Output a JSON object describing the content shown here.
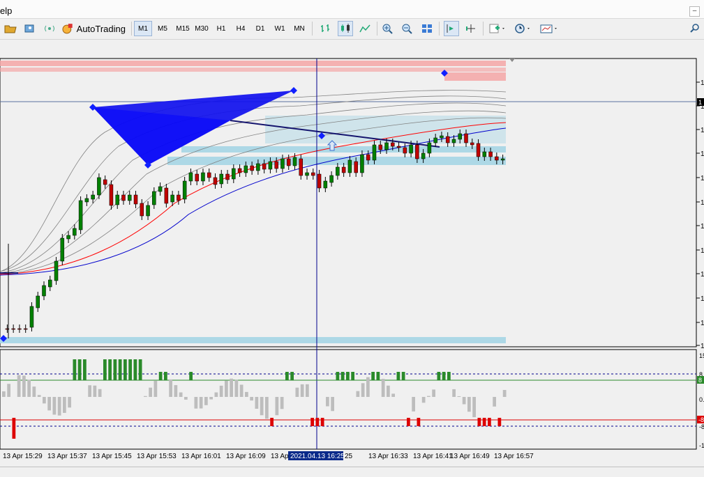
{
  "menubar": {
    "help_label": "elp",
    "minimize_label": "–"
  },
  "toolbar": {
    "autotrading_label": "AutoTrading",
    "timeframes": [
      "M1",
      "M5",
      "M15",
      "M30",
      "H1",
      "H4",
      "D1",
      "W1",
      "MN"
    ],
    "active_timeframe": "M1",
    "left_icons": [
      "folder-icon",
      "profiles-icon",
      "signal-icon"
    ],
    "right_icons": [
      "bar-chart-icon",
      "candlestick-icon",
      "line-chart-icon",
      "zoom-in-icon",
      "zoom-out-icon",
      "tile-windows-icon",
      "autoscroll-icon",
      "chart-shift-icon",
      "indicators-icon",
      "periods-icon",
      "templates-icon",
      "search-icon"
    ]
  },
  "chart_data": {
    "type": "candlestick",
    "symbol_note": "",
    "time_axis_labels": [
      "13 Apr 15:29",
      "13 Apr 15:37",
      "13 Apr 15:45",
      "13 Apr 15:53",
      "13 Apr 16:01",
      "13 Apr 16:09",
      "13 Apr",
      "25",
      "13 Apr 16:33",
      "13 Apr 16:41",
      "13 Apr 16:49",
      "13 Apr 16:57"
    ],
    "crosshair_label": "2021.04.13 16:25",
    "price_axis_labels": [
      "1",
      "1",
      "1",
      "1",
      "1",
      "1",
      "1",
      "1",
      "1",
      "1",
      "1",
      "1",
      "1",
      "1"
    ],
    "price_marker": "1",
    "candles": [
      {
        "o": 392,
        "c": 392
      },
      {
        "o": 392,
        "c": 392
      },
      {
        "o": 392,
        "c": 392
      },
      {
        "o": 392,
        "c": 392
      },
      {
        "o": 390,
        "c": 360
      },
      {
        "o": 362,
        "c": 345
      },
      {
        "o": 345,
        "c": 330
      },
      {
        "o": 332,
        "c": 322
      },
      {
        "o": 323,
        "c": 295
      },
      {
        "o": 295,
        "c": 262
      },
      {
        "o": 263,
        "c": 258
      },
      {
        "o": 258,
        "c": 248
      },
      {
        "o": 250,
        "c": 208
      },
      {
        "o": 210,
        "c": 205
      },
      {
        "o": 206,
        "c": 200
      },
      {
        "o": 200,
        "c": 175
      },
      {
        "o": 178,
        "c": 185
      },
      {
        "o": 185,
        "c": 215
      },
      {
        "o": 214,
        "c": 200
      },
      {
        "o": 200,
        "c": 208
      },
      {
        "o": 208,
        "c": 200
      },
      {
        "o": 200,
        "c": 213
      },
      {
        "o": 212,
        "c": 230
      },
      {
        "o": 230,
        "c": 215
      },
      {
        "o": 214,
        "c": 195
      },
      {
        "o": 195,
        "c": 188
      },
      {
        "o": 190,
        "c": 212
      },
      {
        "o": 210,
        "c": 200
      },
      {
        "o": 200,
        "c": 208
      },
      {
        "o": 206,
        "c": 180
      },
      {
        "o": 180,
        "c": 168
      },
      {
        "o": 170,
        "c": 180
      },
      {
        "o": 180,
        "c": 168
      },
      {
        "o": 168,
        "c": 175
      },
      {
        "o": 175,
        "c": 185
      },
      {
        "o": 184,
        "c": 170
      },
      {
        "o": 170,
        "c": 178
      },
      {
        "o": 177,
        "c": 162
      },
      {
        "o": 162,
        "c": 168
      },
      {
        "o": 168,
        "c": 158
      },
      {
        "o": 158,
        "c": 165
      },
      {
        "o": 165,
        "c": 155
      },
      {
        "o": 155,
        "c": 163
      },
      {
        "o": 163,
        "c": 152
      },
      {
        "o": 152,
        "c": 162
      },
      {
        "o": 162,
        "c": 148
      },
      {
        "o": 148,
        "c": 158
      },
      {
        "o": 158,
        "c": 146
      },
      {
        "o": 148,
        "c": 172
      },
      {
        "o": 172,
        "c": 168
      },
      {
        "o": 168,
        "c": 172
      },
      {
        "o": 170,
        "c": 190
      },
      {
        "o": 190,
        "c": 180
      },
      {
        "o": 182,
        "c": 172
      },
      {
        "o": 172,
        "c": 160
      },
      {
        "o": 160,
        "c": 168
      },
      {
        "o": 168,
        "c": 150
      },
      {
        "o": 152,
        "c": 168
      },
      {
        "o": 168,
        "c": 142
      },
      {
        "o": 142,
        "c": 150
      },
      {
        "o": 150,
        "c": 128
      },
      {
        "o": 128,
        "c": 135
      },
      {
        "o": 135,
        "c": 125
      },
      {
        "o": 125,
        "c": 130
      },
      {
        "o": 130,
        "c": 132
      },
      {
        "o": 132,
        "c": 140
      },
      {
        "o": 140,
        "c": 128
      },
      {
        "o": 128,
        "c": 148
      },
      {
        "o": 148,
        "c": 140
      },
      {
        "o": 140,
        "c": 125
      },
      {
        "o": 125,
        "c": 118
      },
      {
        "o": 118,
        "c": 115
      },
      {
        "o": 116,
        "c": 125
      },
      {
        "o": 125,
        "c": 120
      },
      {
        "o": 120,
        "c": 112
      },
      {
        "o": 112,
        "c": 125
      },
      {
        "o": 125,
        "c": 128
      },
      {
        "o": 126,
        "c": 145
      },
      {
        "o": 145,
        "c": 138
      },
      {
        "o": 138,
        "c": 145
      },
      {
        "o": 145,
        "c": 150
      },
      {
        "o": 150,
        "c": 148
      }
    ],
    "histogram_axis_labels": [
      "15",
      "8",
      "0.",
      "-8",
      "-1"
    ],
    "histogram_markers": [
      "8",
      "-8"
    ],
    "colors": {
      "bull_candle": "#008000",
      "bear_candle": "#c00000",
      "pattern_fill": "#1010ee",
      "support_zone": "#add8e6",
      "resistance_zone": "#f4a6a6",
      "ma_red": "#ff0000",
      "ma_blue": "#0000cc",
      "ma_gray": "#808080"
    }
  }
}
